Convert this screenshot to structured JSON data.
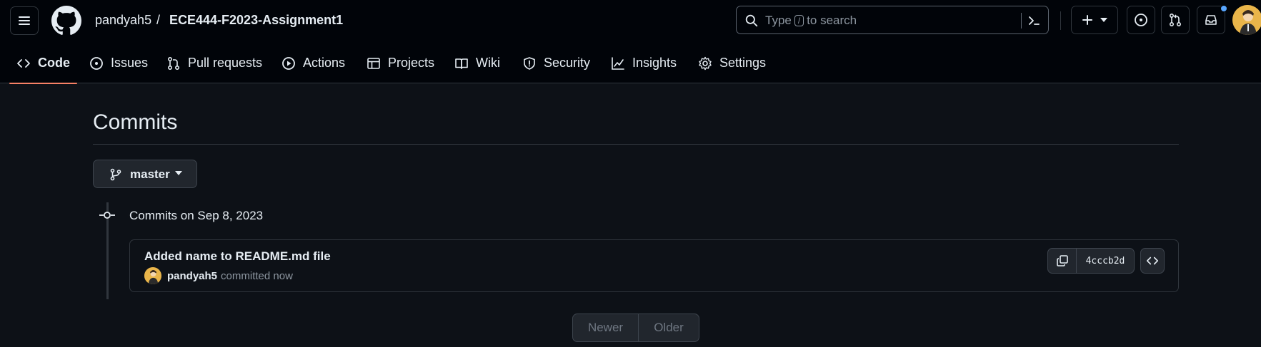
{
  "header": {
    "owner": "pandyah5",
    "separator": "/",
    "repo": "ECE444-F2023-Assignment1",
    "search": {
      "prefix": "Type",
      "key": "/",
      "suffix": "to search"
    }
  },
  "tabs": [
    {
      "label": "Code",
      "icon": "code-icon",
      "active": true
    },
    {
      "label": "Issues",
      "icon": "issue-icon"
    },
    {
      "label": "Pull requests",
      "icon": "pull-request-icon"
    },
    {
      "label": "Actions",
      "icon": "play-icon"
    },
    {
      "label": "Projects",
      "icon": "table-icon"
    },
    {
      "label": "Wiki",
      "icon": "book-icon"
    },
    {
      "label": "Security",
      "icon": "shield-icon"
    },
    {
      "label": "Insights",
      "icon": "graph-icon"
    },
    {
      "label": "Settings",
      "icon": "gear-icon"
    }
  ],
  "page": {
    "title": "Commits"
  },
  "branch": {
    "name": "master"
  },
  "commit_groups": [
    {
      "label": "Commits on Sep 8, 2023",
      "commits": [
        {
          "message": "Added name to README.md file",
          "author": "pandyah5",
          "time": "committed now",
          "sha": "4cccb2d"
        }
      ]
    }
  ],
  "pagination": {
    "newer": "Newer",
    "older": "Older"
  },
  "colors": {
    "accent_underline": "#f78166",
    "notification": "#58a6ff",
    "background": "#0d1117",
    "header_bg": "#010409"
  }
}
